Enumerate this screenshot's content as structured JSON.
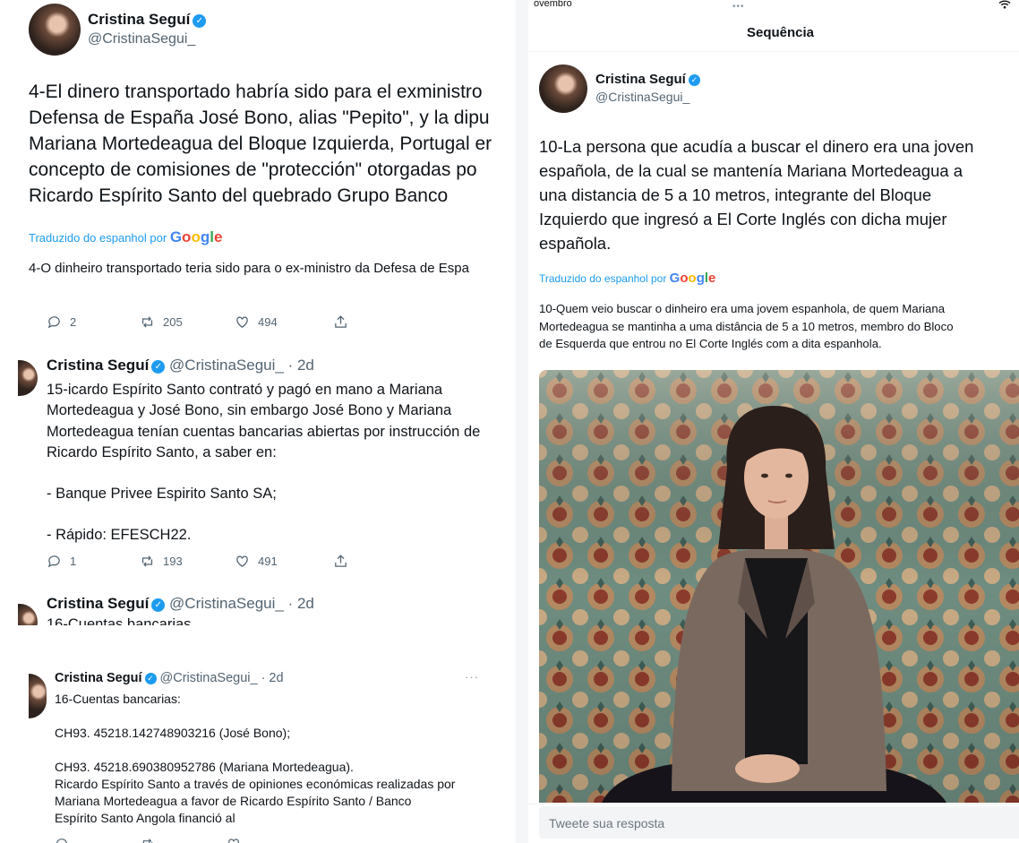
{
  "left_panel": {
    "tweet1": {
      "name": "Cristina Seguí",
      "handle": "@CristinaSegui_",
      "text_lines": [
        "4-El dinero transportado habría sido para el exministro",
        "Defensa de España José Bono, alias \"Pepito\", y la dipu",
        "Mariana Mortedeagua del Bloque Izquierda, Portugal er",
        "concepto de comisiones de \"protección\" otorgadas po",
        "Ricardo Espírito Santo del quebrado Grupo Banco"
      ],
      "translated_label": "Traduzido do espanhol por",
      "translated_brand": "Google",
      "translation": "4-O dinheiro transportado teria sido para o ex-ministro da Defesa de Espa",
      "stats": {
        "replies": "2",
        "retweets": "205",
        "likes": "494"
      }
    },
    "tweet2": {
      "name": "Cristina Seguí",
      "handle_time": "@CristinaSegui_ · 2d",
      "text_lines": [
        "15-icardo Espírito Santo contrató y pagó en mano a Mariana",
        "Mortedeagua y José Bono, sin embargo José Bono y Mariana",
        "Mortedeagua tenían cuentas bancarias abiertas por instrucción de",
        "Ricardo Espírito Santo, a saber en:",
        "",
        "- Banque Privee Espirito Santo SA;",
        "",
        "- Rápido: EFESCH22."
      ],
      "stats": {
        "replies": "1",
        "retweets": "193",
        "likes": "491"
      }
    },
    "tweet3": {
      "name": "Cristina Seguí",
      "handle_time": "@CristinaSegui_ · 2d",
      "partial_text": "16-Cuentas bancarias"
    },
    "tweet4": {
      "name": "Cristina Seguí",
      "handle_time": "@CristinaSegui_ · 2d",
      "more": "···",
      "text_lines": [
        "16-Cuentas bancarias:",
        "",
        "CH93. 45218.142748903216 (José Bono);",
        "",
        "CH93. 45218.690380952786 (Mariana Mortedeagua).",
        "Ricardo Espírito Santo a través de opiniones económicas realizadas por",
        "Mariana Mortedeagua a favor de Ricardo Espírito Santo / Banco",
        "Espírito Santo Angola financió al"
      ]
    }
  },
  "right_panel": {
    "status_bar": {
      "date": "ovembro",
      "dots": "•••"
    },
    "header_title": "Sequência",
    "tweet": {
      "name": "Cristina Seguí",
      "handle": "@CristinaSegui_",
      "text_lines": [
        "10-La persona que acudía a buscar el dinero era una joven",
        "española, de la cual se mantenía Mariana Mortedeagua a",
        "una distancia de 5 a 10 metros, integrante del Bloque",
        "Izquierdo que ingresó a El Corte Inglés con dicha mujer",
        "española."
      ],
      "translated_label": "Traduzido do espanhol por",
      "translated_brand": "Google",
      "translation_lines": [
        "10-Quem veio buscar o dinheiro era uma jovem espanhola, de quem Mariana",
        "Mortedeagua se mantinha a uma distância de 5 a 10 metros, membro do Bloco",
        "de Esquerda que entrou no El Corte Inglés com a dita espanhola."
      ]
    },
    "reply_placeholder": "Tweete sua resposta"
  },
  "colors": {
    "link_blue": "#1d9bf0",
    "muted": "#536471",
    "text": "#0f1419"
  }
}
